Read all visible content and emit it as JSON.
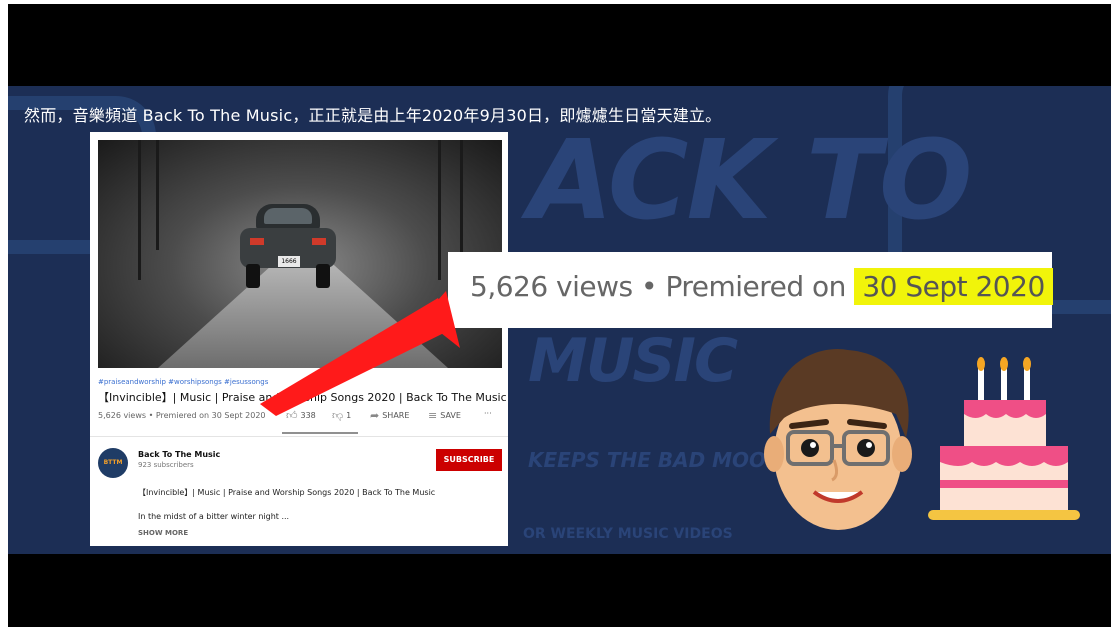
{
  "caption": "然而，音樂頻道 Back To The Music，正正就是由上年2020年9月30日，即爈爈生日當天建立。",
  "background": {
    "brand_letters": "ACK TO",
    "music_text": "MUSIC",
    "tagline": "KEEPS THE BAD MOODS AWAY",
    "weekly": "OR WEEKLY MUSIC VIDEOS"
  },
  "video_card": {
    "plate": "1666",
    "hashtags": "#praiseandworship #worshipsongs #jesussongs",
    "title": "【Invincible】| Music | Praise and Worship Songs 2020 | Back To The Music",
    "meta": "5,626 views • Premiered on 30 Sept 2020",
    "likes": "338",
    "dislikes": "1",
    "share_label": "SHARE",
    "save_label": "SAVE",
    "more_label": "···",
    "channel_name": "Back To The Music",
    "subscribers": "923 subscribers",
    "subscribe_label": "SUBSCRIBE",
    "avatar_text": "BTTM",
    "description_line1": "【Invincible】| Music | Praise and Worship Songs 2020 | Back To The Music",
    "description_line2": "In the midst of a bitter winter night ...",
    "show_more": "SHOW MORE"
  },
  "zoom": {
    "prefix": "5,626 views • Premiered on ",
    "highlight": "30 Sept 2020"
  },
  "colors": {
    "stage_bg": "#1c2e55",
    "highlight": "#f1f40a",
    "arrow": "#ff1a1a",
    "subscribe": "#cc0000"
  }
}
